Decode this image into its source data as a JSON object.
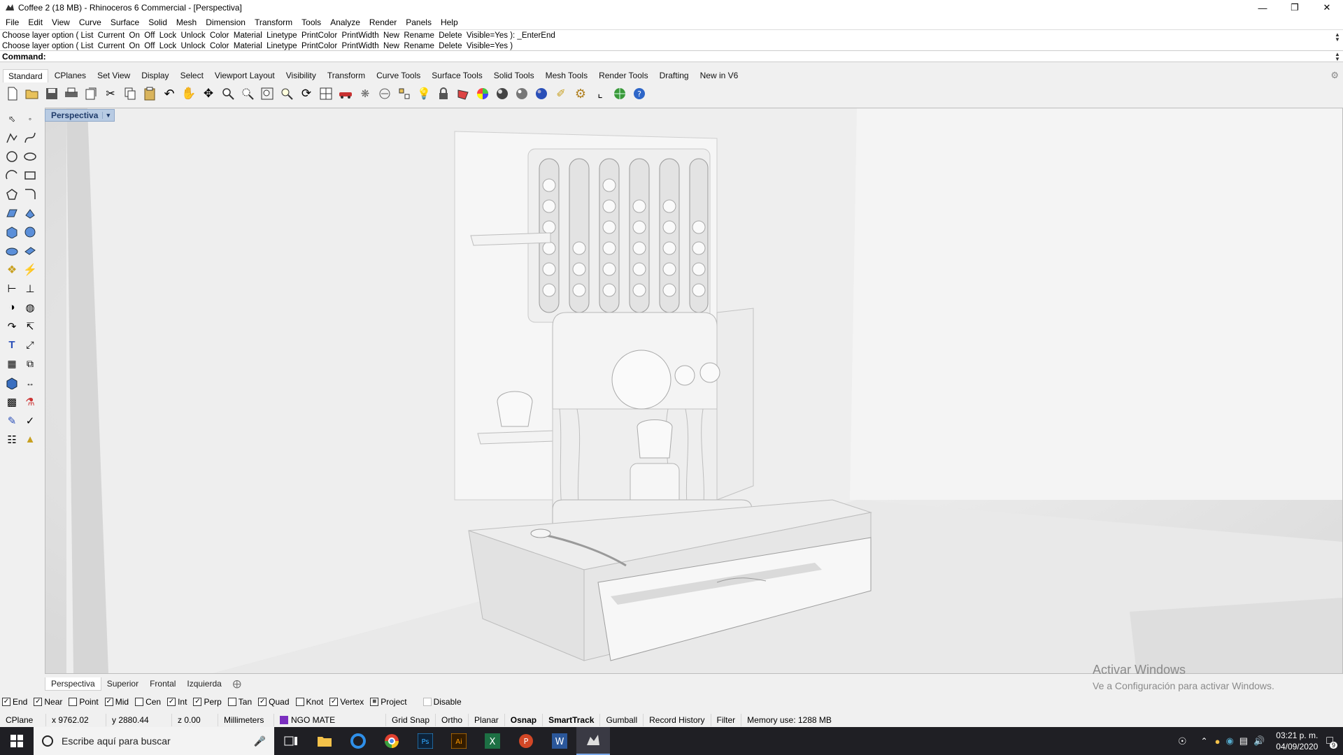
{
  "window": {
    "title": "Coffee 2 (18 MB) - Rhinoceros 6 Commercial - [Perspectiva]"
  },
  "menu": [
    "File",
    "Edit",
    "View",
    "Curve",
    "Surface",
    "Solid",
    "Mesh",
    "Dimension",
    "Transform",
    "Tools",
    "Analyze",
    "Render",
    "Panels",
    "Help"
  ],
  "command": {
    "history": [
      "Choose layer option ( List  Current  On  Off  Lock  Unlock  Color  Material  Linetype  PrintColor  PrintWidth  New  Rename  Delete  Visible=Yes ): _EnterEnd",
      "Choose layer option ( List  Current  On  Off  Lock  Unlock  Color  Material  Linetype  PrintColor  PrintWidth  New  Rename  Delete  Visible=Yes )"
    ],
    "prompt": "Command:"
  },
  "toolbar_tabs": [
    "Standard",
    "CPlanes",
    "Set View",
    "Display",
    "Select",
    "Viewport Layout",
    "Visibility",
    "Transform",
    "Curve Tools",
    "Surface Tools",
    "Solid Tools",
    "Mesh Tools",
    "Render Tools",
    "Drafting",
    "New in V6"
  ],
  "viewport": {
    "label": "Perspectiva"
  },
  "view_tabs": [
    "Perspectiva",
    "Superior",
    "Frontal",
    "Izquierda"
  ],
  "osnaps": [
    {
      "label": "End",
      "checked": true
    },
    {
      "label": "Near",
      "checked": true
    },
    {
      "label": "Point",
      "checked": false
    },
    {
      "label": "Mid",
      "checked": true
    },
    {
      "label": "Cen",
      "checked": false
    },
    {
      "label": "Int",
      "checked": true
    },
    {
      "label": "Perp",
      "checked": true
    },
    {
      "label": "Tan",
      "checked": false
    },
    {
      "label": "Quad",
      "checked": true
    },
    {
      "label": "Knot",
      "checked": false
    },
    {
      "label": "Vertex",
      "checked": true
    },
    {
      "label": "Project",
      "checked": true
    },
    {
      "label": "Disable",
      "checked": false
    }
  ],
  "status": {
    "cplane": "CPlane",
    "x": "x 9762.02",
    "y": "y 2880.44",
    "z": "z 0.00",
    "units": "Millimeters",
    "layer": "NGO MATE",
    "layer_color": "#7b2fbf",
    "grid_snap": "Grid Snap",
    "ortho": "Ortho",
    "planar": "Planar",
    "osnap": "Osnap",
    "smarttrack": "SmartTrack",
    "gumball": "Gumball",
    "record_history": "Record History",
    "filter": "Filter",
    "memory": "Memory use: 1288 MB"
  },
  "watermark": {
    "line1": "Activar Windows",
    "line2": "Ve a Configuración para activar Windows."
  },
  "taskbar": {
    "search_placeholder": "Escribe aquí para buscar",
    "time": "03:21 p. m.",
    "date": "04/09/2020",
    "notif_count": "9"
  }
}
